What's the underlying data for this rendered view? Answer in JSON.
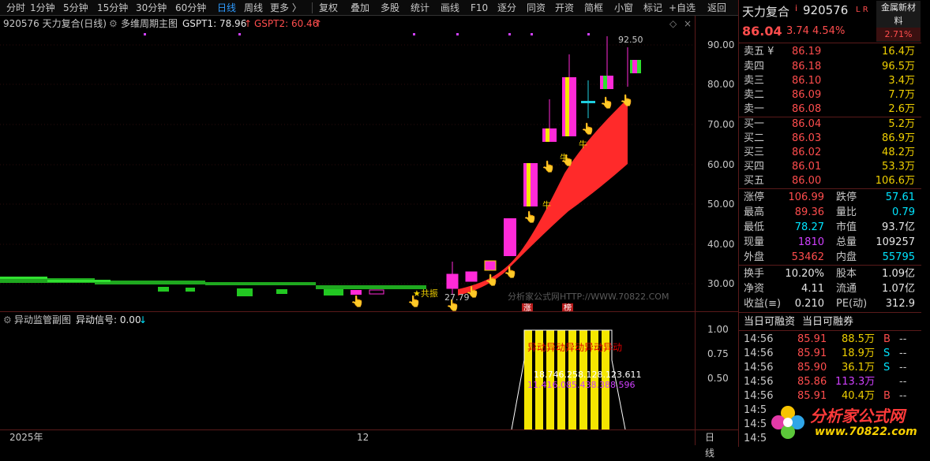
{
  "toolbar": {
    "periods": [
      "分时",
      "1分钟",
      "5分钟",
      "15分钟",
      "30分钟",
      "60分钟",
      "日线",
      "周线",
      "更多 〉"
    ],
    "active_period": "日线",
    "tools": [
      "复权",
      "叠加",
      "多股",
      "统计",
      "画线",
      "F10",
      "逐分",
      "同资",
      "开资",
      "简框",
      "小窗",
      "标记",
      "+自选",
      "返回"
    ]
  },
  "chart_header": {
    "stock_label": "920576 天力复合(日线)",
    "indicator_name": "多维周期主图",
    "gspt1": "GSPT1: 78.96",
    "gspt1_arrow": "↑",
    "gspt2": "GSPT2: 60.46",
    "gspt2_arrow": "↑"
  },
  "main_chart": {
    "y_ticks": [
      "90.00",
      "80.00",
      "70.00",
      "60.00",
      "50.00",
      "40.00",
      "30.00"
    ],
    "high_label": "92.50",
    "low_label": "27.79",
    "star_label": "★共振",
    "bull_label": "牛",
    "watermark": "分析家公式网HTTP://WWW.70822.COM",
    "tag_zhang": "涨",
    "tag_bang": "榜"
  },
  "sub_chart": {
    "name": "异动监管副图",
    "signal": "异动信号: 0.00",
    "signal_arrow": "↓",
    "y_ticks": [
      "1.00",
      "0.75",
      "0.50"
    ],
    "alert_text": "异动异动异动异动异动",
    "value_row1": "18.746.258.128.123.611",
    "value_row2": "11.416.085.438.388.596"
  },
  "date_axis": {
    "year": "2025年",
    "month": "12",
    "period": "日线"
  },
  "quote": {
    "name": "天力复合",
    "flag": "i",
    "code": "920576",
    "lr": "L R",
    "price": "86.04",
    "change": "3.74",
    "change_pct": "4.54%",
    "sector": "金属新材料",
    "sector_pct": "2.71%",
    "asks": [
      {
        "label": "卖五 ¥",
        "price": "86.19",
        "vol": "16.4万"
      },
      {
        "label": "卖四",
        "price": "86.18",
        "vol": "96.5万"
      },
      {
        "label": "卖三",
        "price": "86.10",
        "vol": "3.4万"
      },
      {
        "label": "卖二",
        "price": "86.09",
        "vol": "7.7万"
      },
      {
        "label": "卖一",
        "price": "86.08",
        "vol": "2.6万"
      }
    ],
    "bids": [
      {
        "label": "买一",
        "price": "86.04",
        "vol": "5.2万"
      },
      {
        "label": "买二",
        "price": "86.03",
        "vol": "86.9万"
      },
      {
        "label": "买三",
        "price": "86.02",
        "vol": "48.2万"
      },
      {
        "label": "买四",
        "price": "86.01",
        "vol": "53.3万"
      },
      {
        "label": "买五",
        "price": "86.00",
        "vol": "106.6万"
      }
    ],
    "stats": [
      {
        "l1": "涨停",
        "v1": "106.99",
        "l2": "跌停",
        "v2": "57.61"
      },
      {
        "l1": "最高",
        "v1": "89.36",
        "l2": "量比",
        "v2": "0.79"
      },
      {
        "l1": "最低",
        "v1": "78.27",
        "l2": "市值",
        "v2": "93.7亿"
      },
      {
        "l1": "现量",
        "v1": "1810",
        "l2": "总量",
        "v2": "109257"
      },
      {
        "l1": "外盘",
        "v1": "53462",
        "l2": "内盘",
        "v2": "55795"
      }
    ],
    "fin": [
      {
        "l1": "换手",
        "v1": "10.20%",
        "l2": "股本",
        "v2": "1.09亿"
      },
      {
        "l1": "净资",
        "v1": "4.11",
        "l2": "流通",
        "v2": "1.07亿"
      },
      {
        "l1": "收益(≡)",
        "v1": "0.210",
        "l2": "PE(动)",
        "v2": "312.9"
      }
    ],
    "margin_tabs": [
      "当日可融资",
      "当日可融券"
    ],
    "trades": [
      {
        "time": "14:56",
        "price": "85.91",
        "vol": "88.5万",
        "side": "B",
        "tail": "--"
      },
      {
        "time": "14:56",
        "price": "85.91",
        "vol": "18.9万",
        "side": "S",
        "tail": "--"
      },
      {
        "time": "14:56",
        "price": "85.90",
        "vol": "36.1万",
        "side": "S",
        "tail": "--"
      },
      {
        "time": "14:56",
        "price": "85.86",
        "vol": "113.3万",
        "side": "",
        "tail": "--"
      },
      {
        "time": "14:56",
        "price": "85.91",
        "vol": "40.4万",
        "side": "B",
        "tail": "--"
      },
      {
        "time": "14:5",
        "price": "",
        "vol": "",
        "side": "",
        "tail": ""
      },
      {
        "time": "14:5",
        "price": "",
        "vol": "",
        "side": "",
        "tail": ""
      },
      {
        "time": "14:5",
        "price": "",
        "vol": "",
        "side": "",
        "tail": ""
      }
    ]
  },
  "logo": {
    "title": "分析家公式网",
    "url": "www.70822.com"
  }
}
